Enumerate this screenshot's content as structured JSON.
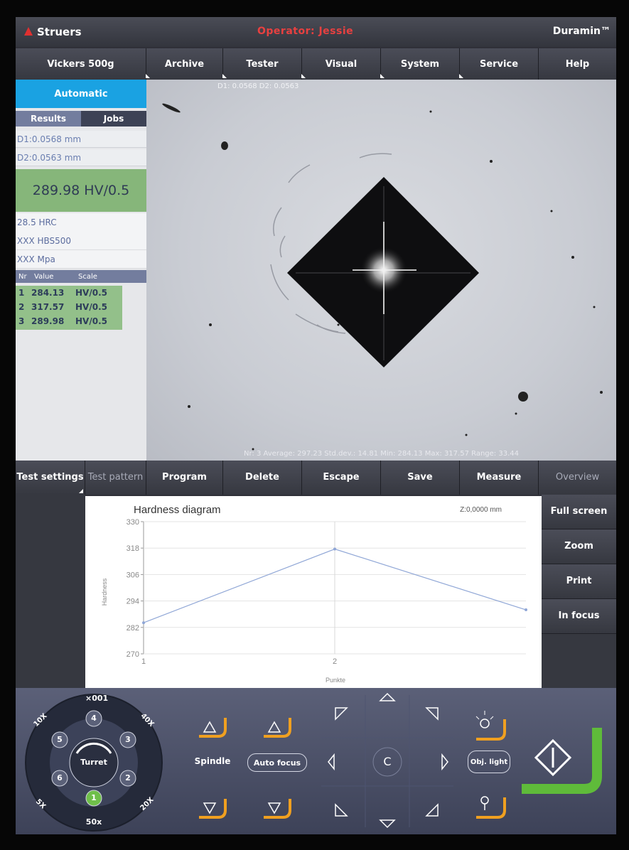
{
  "titlebar": {
    "brand": "Struers",
    "operator": "Operator: Jessie",
    "product": "Duramin™"
  },
  "topmenu": [
    "Vickers 500g",
    "Archive",
    "Tester",
    "Visual",
    "System",
    "Service",
    "Help"
  ],
  "left": {
    "mode": "Automatic",
    "tabs": [
      "Results",
      "Jobs"
    ],
    "d1": "D1:0.0568 mm",
    "d2": "D2:0.0563 mm",
    "result": "289.98 HV/0.5",
    "conversions": [
      "28.5 HRC",
      "XXX HBS500",
      "XXX Mpa"
    ],
    "table_headers": [
      "Nr",
      "Value",
      "Scale"
    ],
    "table_rows": [
      {
        "nr": "1",
        "value": "284.13",
        "scale": "HV/0.5"
      },
      {
        "nr": "2",
        "value": "317.57",
        "scale": "HV/0.5"
      },
      {
        "nr": "3",
        "value": "289.98",
        "scale": "HV/0.5"
      }
    ]
  },
  "image": {
    "top_text": "D1: 0.0568    D2: 0.0563",
    "stats": "Nr: 3   Average: 297.23   Std.dev.: 14.81   Min: 284.13   Max: 317.57   Range: 33.44"
  },
  "bottombar": [
    {
      "label": "Test settings"
    },
    {
      "label": "Test pattern"
    },
    {
      "label": "Program"
    },
    {
      "label": "Delete"
    },
    {
      "label": "Escape"
    },
    {
      "label": "Save"
    },
    {
      "label": "Measure"
    },
    {
      "label": "Overview"
    }
  ],
  "sidebuttons": [
    "Full screen",
    "Zoom",
    "Print",
    "In focus"
  ],
  "chart_data": {
    "type": "line",
    "title": "Hardness diagram",
    "z_readout": "Z:0,0000 mm",
    "ylabel": "Hardness",
    "xlabel": "Punkte",
    "x": [
      1,
      2,
      3
    ],
    "xticks": [
      "1",
      "2"
    ],
    "values": [
      284.13,
      317.57,
      289.98
    ],
    "yticks": [
      270,
      282,
      294,
      306,
      318,
      330
    ],
    "ylim": [
      270,
      330
    ],
    "grid": true,
    "line_color": "#8fa6d6"
  },
  "controls": {
    "turret": {
      "center_label": "Turret",
      "top_label": "×001",
      "bottom_label": "50x",
      "positions": [
        "1",
        "2",
        "3",
        "4",
        "5",
        "6"
      ],
      "side_labels": [
        "10X",
        "40X",
        "20X",
        "5X"
      ]
    },
    "spindle_label": "Spindle",
    "autofocus_label": "Auto focus",
    "center_label": "C",
    "objlight_label": "Obj. light",
    "accent": "#f0a020",
    "start_accent": "#5fbb3a"
  }
}
